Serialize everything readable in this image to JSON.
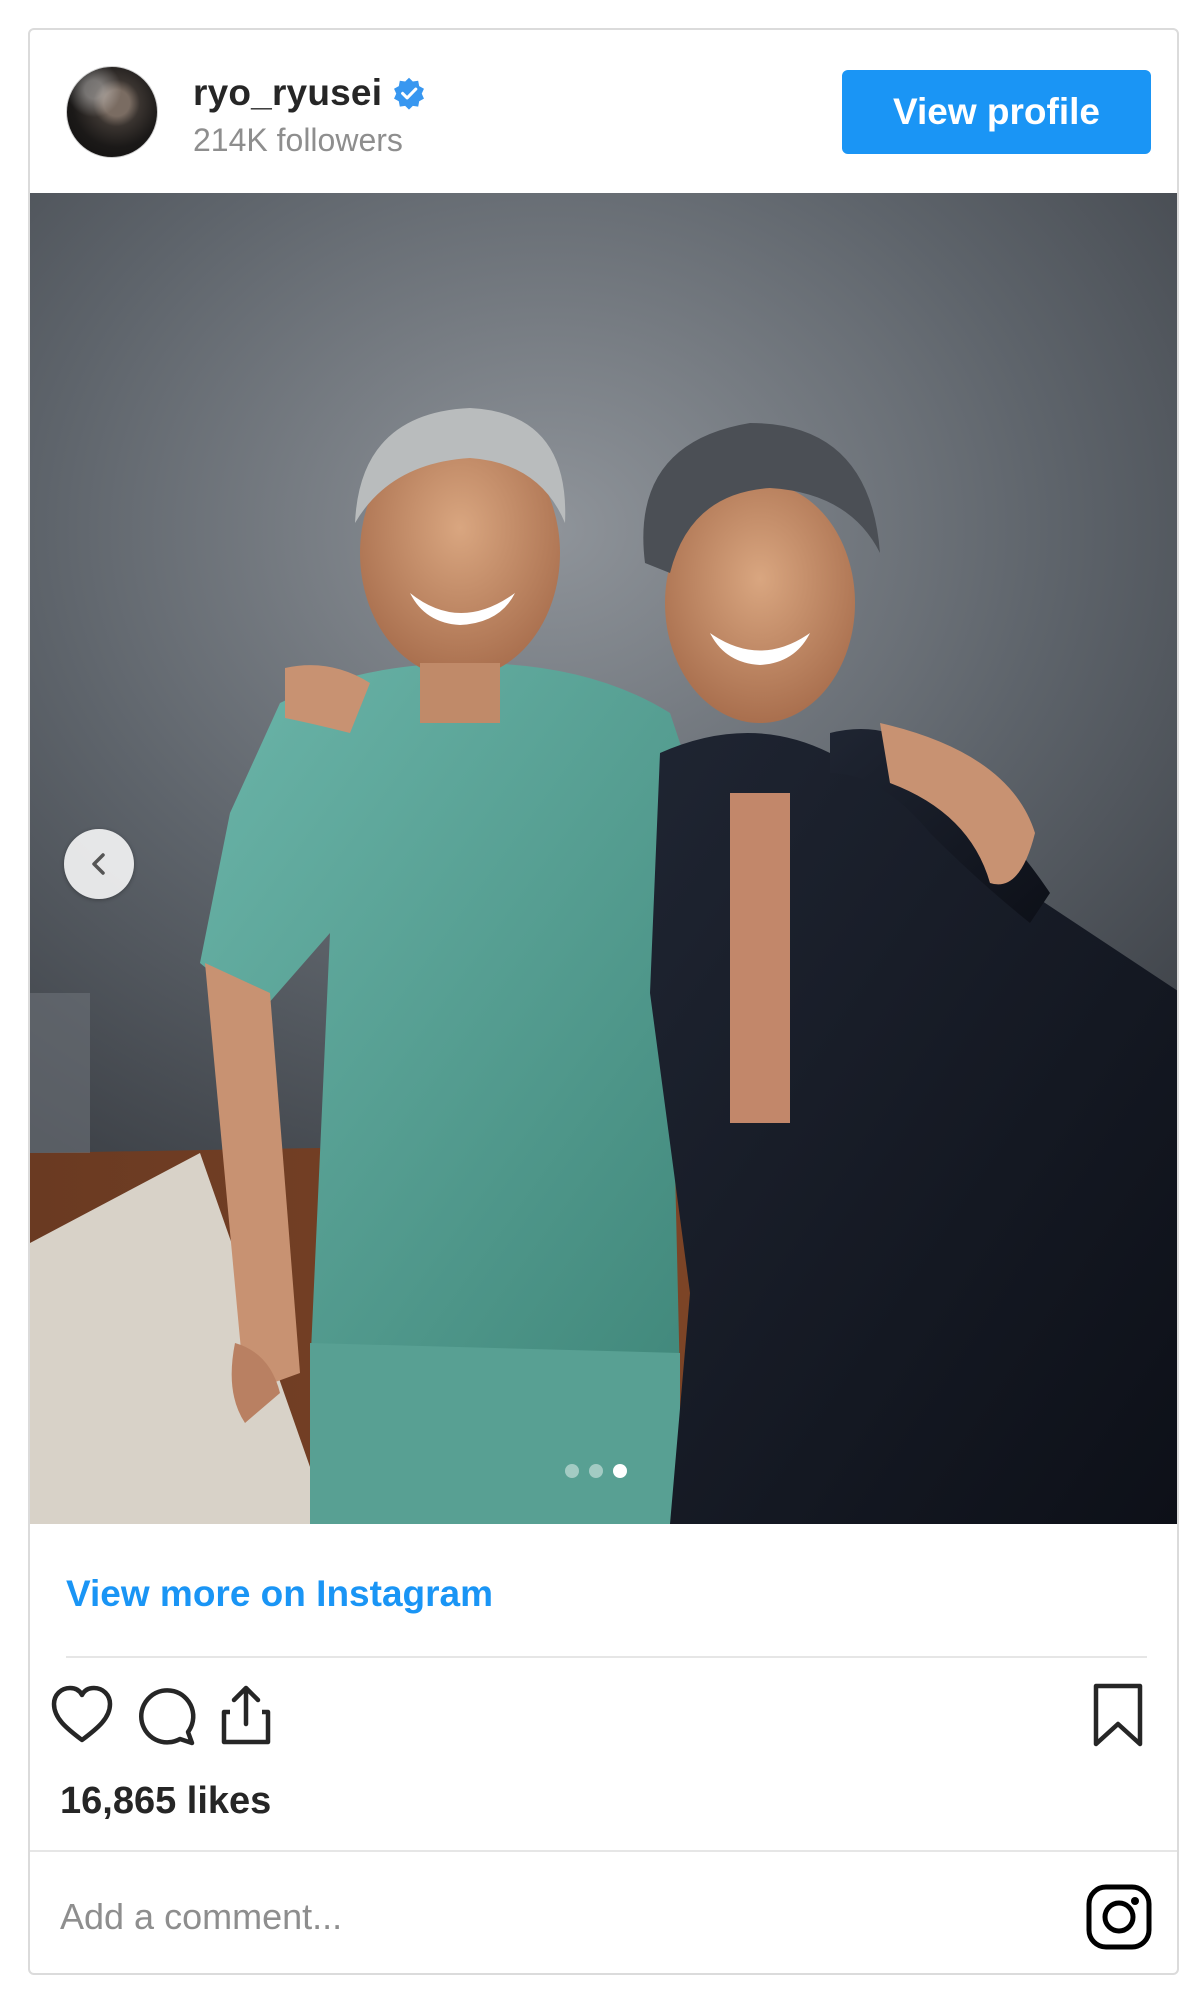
{
  "header": {
    "username": "ryo_ryusei",
    "verified": true,
    "followers": "214K followers",
    "view_profile_label": "View profile"
  },
  "carousel": {
    "current_slide": 3,
    "total_slides": 3
  },
  "link": {
    "view_more_label": "View more on Instagram"
  },
  "actions": {
    "icons": [
      "heart-icon",
      "comment-icon",
      "share-icon",
      "bookmark-icon"
    ]
  },
  "likes": "16,865 likes",
  "comment": {
    "placeholder": "Add a comment..."
  },
  "colors": {
    "accent": "#1a95f5",
    "text": "#262626",
    "muted": "#8e8e8e",
    "border": "#dbdbdb"
  }
}
